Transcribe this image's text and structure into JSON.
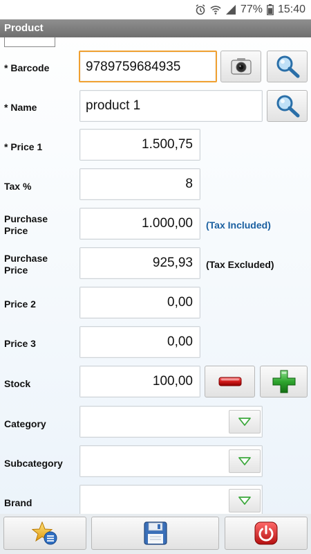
{
  "status_bar": {
    "battery": "77%",
    "time": "15:40"
  },
  "title_bar": {
    "title": "Product"
  },
  "form": {
    "barcode": {
      "label": "* Barcode",
      "value": "9789759684935"
    },
    "name": {
      "label": "* Name",
      "value": "product 1"
    },
    "price1": {
      "label": "* Price 1",
      "value": "1.500,75"
    },
    "tax": {
      "label": "Tax %",
      "value": "8"
    },
    "purchase_incl": {
      "label": "Purchase Price",
      "value": "1.000,00",
      "note": "(Tax Included)"
    },
    "purchase_excl": {
      "label": "Purchase Price",
      "value": "925,93",
      "note": "(Tax Excluded)"
    },
    "price2": {
      "label": "Price 2",
      "value": "0,00"
    },
    "price3": {
      "label": "Price 3",
      "value": "0,00"
    },
    "stock": {
      "label": "Stock",
      "value": "100,00"
    },
    "category": {
      "label": "Category",
      "value": ""
    },
    "subcategory": {
      "label": "Subcategory",
      "value": ""
    },
    "brand": {
      "label": "Brand",
      "value": ""
    }
  },
  "colors": {
    "tax_included_note": "#1a5fa0",
    "focus_border": "#f0a030",
    "minus_red": "#d11a1a",
    "plus_green": "#2fa52f",
    "arrow_green": "#3ca83c"
  },
  "icons": {
    "camera": "camera-icon",
    "search": "magnifier-icon",
    "minus": "minus-icon",
    "plus": "plus-icon",
    "dropdown": "triangle-down-icon",
    "favorites": "star-list-icon",
    "save": "floppy-disk-icon",
    "exit": "power-icon"
  }
}
